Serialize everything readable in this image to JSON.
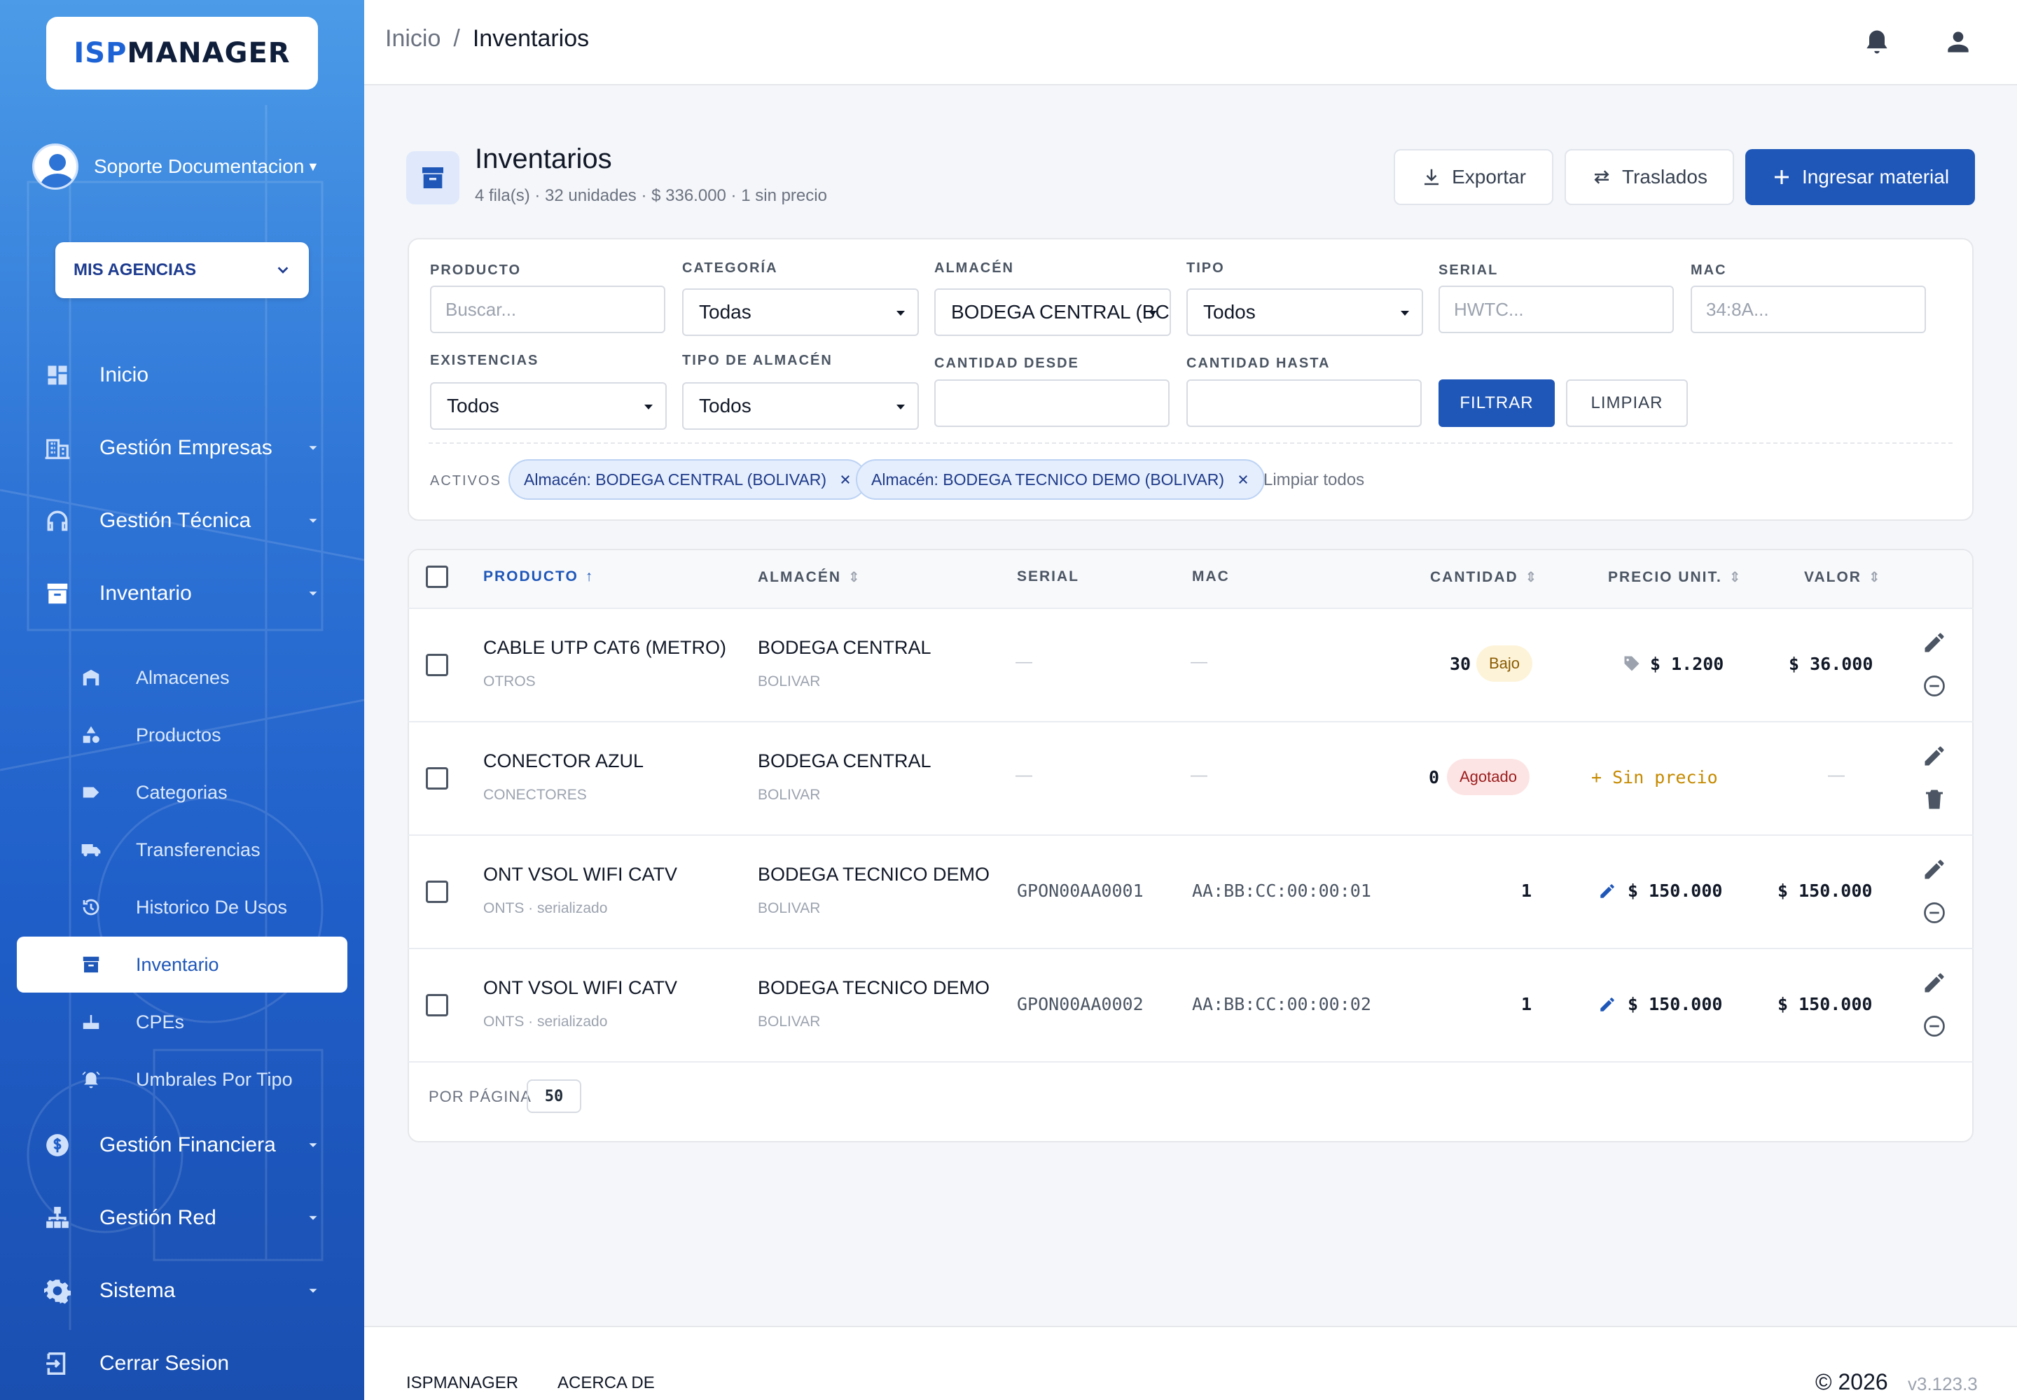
{
  "app": {
    "logo_isp": "ISP",
    "logo_manager": "MANAGER"
  },
  "user": {
    "name": "Soporte Documentacion"
  },
  "agency": {
    "label": "MIS AGENCIAS"
  },
  "sidebar": {
    "items": [
      {
        "label": "Inicio",
        "icon": "dashboard-icon"
      },
      {
        "label": "Gestión Empresas",
        "icon": "building-icon"
      },
      {
        "label": "Gestión Técnica",
        "icon": "headset-icon"
      },
      {
        "label": "Inventario",
        "icon": "archive-icon"
      },
      {
        "label": "Gestión Financiera",
        "icon": "dollar-icon"
      },
      {
        "label": "Gestión Red",
        "icon": "network-icon"
      },
      {
        "label": "Sistema",
        "icon": "gear-icon"
      },
      {
        "label": "Cerrar Sesion",
        "icon": "logout-icon"
      }
    ],
    "sub_items": [
      {
        "label": "Almacenes",
        "icon": "warehouse-icon"
      },
      {
        "label": "Productos",
        "icon": "shapes-icon"
      },
      {
        "label": "Categorias",
        "icon": "tag-icon"
      },
      {
        "label": "Transferencias",
        "icon": "truck-icon"
      },
      {
        "label": "Historico De Usos",
        "icon": "history-icon"
      },
      {
        "label": "Inventario",
        "icon": "archive-icon"
      },
      {
        "label": "CPEs",
        "icon": "router-icon"
      },
      {
        "label": "Umbrales Por Tipo",
        "icon": "alarm-icon"
      }
    ]
  },
  "breadcrumb": {
    "home": "Inicio",
    "sep": "/",
    "current": "Inventarios"
  },
  "page": {
    "title": "Inventarios",
    "subtitle": "4 fila(s) · 32 unidades · $ 336.000 · 1 sin precio",
    "export_label": "Exportar",
    "transfers_label": "Traslados",
    "add_label": "Ingresar material"
  },
  "filters": {
    "producto": {
      "label": "PRODUCTO",
      "placeholder": "Buscar..."
    },
    "categoria": {
      "label": "CATEGORÍA",
      "value": "Todas"
    },
    "almacen": {
      "label": "ALMACÉN",
      "value": "BODEGA CENTRAL (BC"
    },
    "tipo": {
      "label": "TIPO",
      "value": "Todos"
    },
    "serial": {
      "label": "SERIAL",
      "placeholder": "HWTC..."
    },
    "mac": {
      "label": "MAC",
      "placeholder": "34:8A..."
    },
    "existencias": {
      "label": "EXISTENCIAS",
      "value": "Todos"
    },
    "tipo_almacen": {
      "label": "TIPO DE ALMACÉN",
      "value": "Todos"
    },
    "cantidad_desde": {
      "label": "CANTIDAD DESDE",
      "value": ""
    },
    "cantidad_hasta": {
      "label": "CANTIDAD HASTA",
      "value": ""
    },
    "filtrar_label": "FILTRAR",
    "limpiar_label": "LIMPIAR",
    "activos_label": "ACTIVOS",
    "chips": [
      "Almacén: BODEGA CENTRAL (BOLIVAR)",
      "Almacén: BODEGA TECNICO DEMO (BOLIVAR)"
    ],
    "clear_all": "Limpiar todos"
  },
  "table": {
    "headers": {
      "producto": "PRODUCTO",
      "almacen": "ALMACÉN",
      "serial": "SERIAL",
      "mac": "MAC",
      "cantidad": "CANTIDAD",
      "precio": "PRECIO UNIT.",
      "valor": "VALOR"
    },
    "rows": [
      {
        "producto": "CABLE UTP CAT6 (METRO)",
        "categoria": "OTROS",
        "almacen": "BODEGA CENTRAL",
        "zona": "BOLIVAR",
        "serial": "—",
        "mac": "—",
        "cantidad": "30",
        "badge": "Bajo",
        "precio": "$ 1.200",
        "valor": "$ 36.000"
      },
      {
        "producto": "CONECTOR AZUL",
        "categoria": "CONECTORES",
        "almacen": "BODEGA CENTRAL",
        "zona": "BOLIVAR",
        "serial": "—",
        "mac": "—",
        "cantidad": "0",
        "badge": "Agotado",
        "precio": "+ Sin precio",
        "valor": "—"
      },
      {
        "producto": "ONT VSOL WIFI CATV",
        "categoria": "ONTS · serializado",
        "almacen": "BODEGA TECNICO DEMO",
        "zona": "BOLIVAR",
        "serial": "GPON00AA0001",
        "mac": "AA:BB:CC:00:00:01",
        "cantidad": "1",
        "badge": "",
        "precio": "$ 150.000",
        "valor": "$ 150.000"
      },
      {
        "producto": "ONT VSOL WIFI CATV",
        "categoria": "ONTS · serializado",
        "almacen": "BODEGA TECNICO DEMO",
        "zona": "BOLIVAR",
        "serial": "GPON00AA0002",
        "mac": "AA:BB:CC:00:00:02",
        "cantidad": "1",
        "badge": "",
        "precio": "$ 150.000",
        "valor": "$ 150.000"
      }
    ],
    "per_page_label": "POR PÁGINA",
    "per_page_value": "50"
  },
  "footer": {
    "brand": "ISPMANAGER",
    "about": "ACERCA DE",
    "copyright": "© 2026",
    "version": "v3.123.3"
  },
  "colors": {
    "primary": "#1f57b8",
    "sidebar_top": "#4b9be8",
    "sidebar_bottom": "#1a4fb0",
    "badge_low_bg": "#fdf3d9",
    "badge_low_fg": "#8a5a00",
    "badge_out_bg": "#fde4e4",
    "badge_out_fg": "#9b1c1c",
    "warn": "#c58a00"
  }
}
